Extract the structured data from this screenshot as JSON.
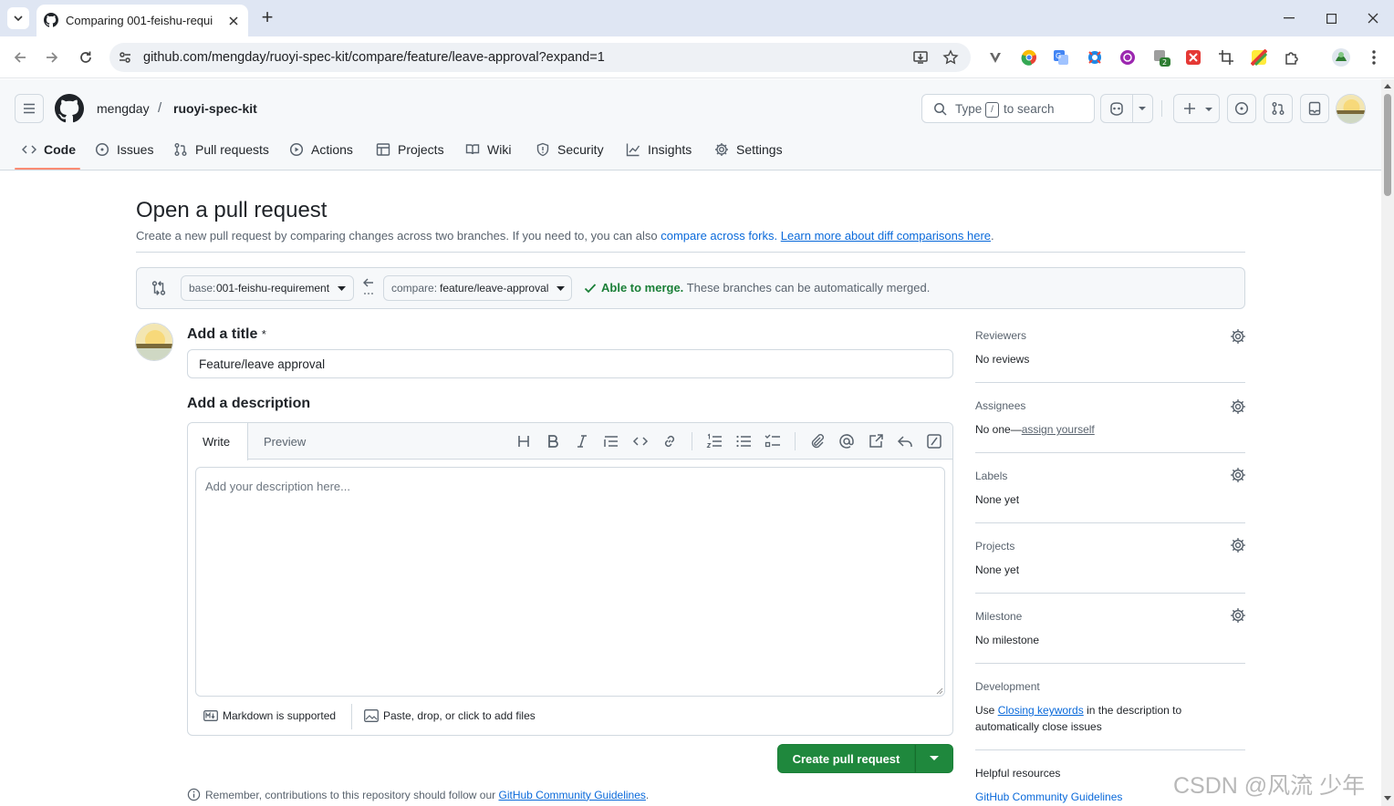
{
  "browser": {
    "tab_title": "Comparing 001-feishu-requi",
    "new_tab": "+",
    "url_main": "github.com/mengday/ruoyi-spec-kit/compare/feature/leave-approval?expand=1"
  },
  "header": {
    "owner": "mengday",
    "slash": "/",
    "repo": "ruoyi-spec-kit",
    "search_type": "Type",
    "search_key": "/",
    "search_rest": "to search"
  },
  "nav": [
    {
      "label": "Code",
      "icon": "code-icon"
    },
    {
      "label": "Issues",
      "icon": "issue-icon"
    },
    {
      "label": "Pull requests",
      "icon": "pull-request-icon"
    },
    {
      "label": "Actions",
      "icon": "play-icon"
    },
    {
      "label": "Projects",
      "icon": "table-icon"
    },
    {
      "label": "Wiki",
      "icon": "book-icon"
    },
    {
      "label": "Security",
      "icon": "shield-icon"
    },
    {
      "label": "Insights",
      "icon": "graph-icon"
    },
    {
      "label": "Settings",
      "icon": "gear-icon"
    }
  ],
  "page": {
    "title": "Open a pull request",
    "subtitle_pre": "Create a new pull request by comparing changes across two branches. If you need to, you can also",
    "compare_forks": "compare across forks.",
    "learn_more": "Learn more about diff comparisons here",
    "period": "."
  },
  "compare": {
    "base_prefix": "base:",
    "base_branch": "001-feishu-requirement",
    "compare_prefix": "compare:",
    "compare_branch": "feature/leave-approval",
    "merge_status": "Able to merge.",
    "merge_text": "These branches can be automatically merged."
  },
  "form": {
    "title_label": "Add a title",
    "required_mark": "*",
    "title_value": "Feature/leave approval",
    "desc_label": "Add a description",
    "tab_write": "Write",
    "tab_preview": "Preview",
    "desc_placeholder": "Add your description here...",
    "markdown_note": "Markdown is supported",
    "attach_note": "Paste, drop, or click to add files",
    "create_button": "Create pull request",
    "remember_pre": "Remember, contributions to this repository should follow our",
    "remember_link": "GitHub Community Guidelines",
    "remember_post": "."
  },
  "sidebar": {
    "reviewers": {
      "heading": "Reviewers",
      "value": "No reviews"
    },
    "assignees": {
      "heading": "Assignees",
      "value_pre": "No one—",
      "value_link": "assign yourself"
    },
    "labels": {
      "heading": "Labels",
      "value": "None yet"
    },
    "projects": {
      "heading": "Projects",
      "value": "None yet"
    },
    "milestone": {
      "heading": "Milestone",
      "value": "No milestone"
    },
    "development": {
      "heading": "Development",
      "pre": "Use",
      "link": "Closing keywords",
      "post": "in the description to",
      "line2": "automatically close issues"
    },
    "helpful": {
      "heading": "Helpful resources",
      "link": "GitHub Community Guidelines"
    }
  },
  "watermark": "CSDN @风流 少年",
  "colors": {
    "accent": "#0969da",
    "success": "#1a7f37",
    "nav_underline": "#fd8c73",
    "button_green": "#1f883d"
  }
}
